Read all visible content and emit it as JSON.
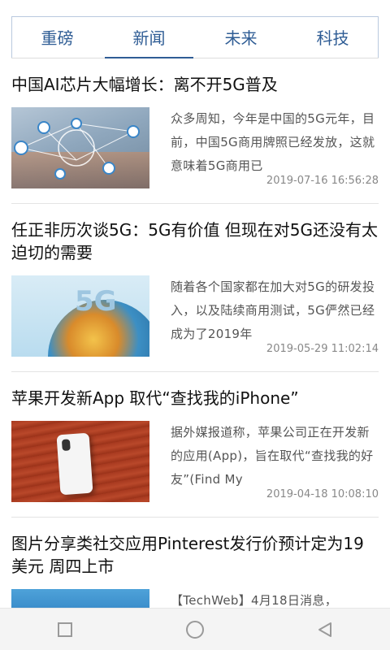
{
  "tabs": [
    {
      "label": "重磅",
      "active": false
    },
    {
      "label": "新闻",
      "active": true
    },
    {
      "label": "未来",
      "active": false
    },
    {
      "label": "科技",
      "active": false
    }
  ],
  "articles": [
    {
      "title": "中国AI芯片大幅增长：离不开5G普及",
      "summary": "众多周知，今年是中国的5G元年，目前，中国5G商用牌照已经发放，这就意味着5G商用已",
      "time": "2019-07-16 16:56:28"
    },
    {
      "title": "任正非历次谈5G：5G有价值 但现在对5G还没有太迫切的需要",
      "summary": "随着各个国家都在加大对5G的研发投入，以及陆续商用测试，5G俨然已经成为了2019年",
      "time": "2019-05-29 11:02:14",
      "image_text": "5G"
    },
    {
      "title": "苹果开发新App 取代“查找我的iPhone”",
      "summary": "据外媒报道称，苹果公司正在开发新的应用(App)，旨在取代“查找我的好友”(Find My",
      "time": "2019-04-18 10:08:10"
    },
    {
      "title": "图片分享类社交应用Pinterest发行价预计定为19美元 周四上市",
      "summary": "【TechWeb】4月18日消息，",
      "time": ""
    }
  ],
  "navbar": {
    "icons": [
      "square-recents-icon",
      "circle-home-icon",
      "triangle-back-icon"
    ],
    "color": "#9a9a9a"
  },
  "colors": {
    "accent": "#2f5d95",
    "tab_border": "#b9c9de"
  }
}
